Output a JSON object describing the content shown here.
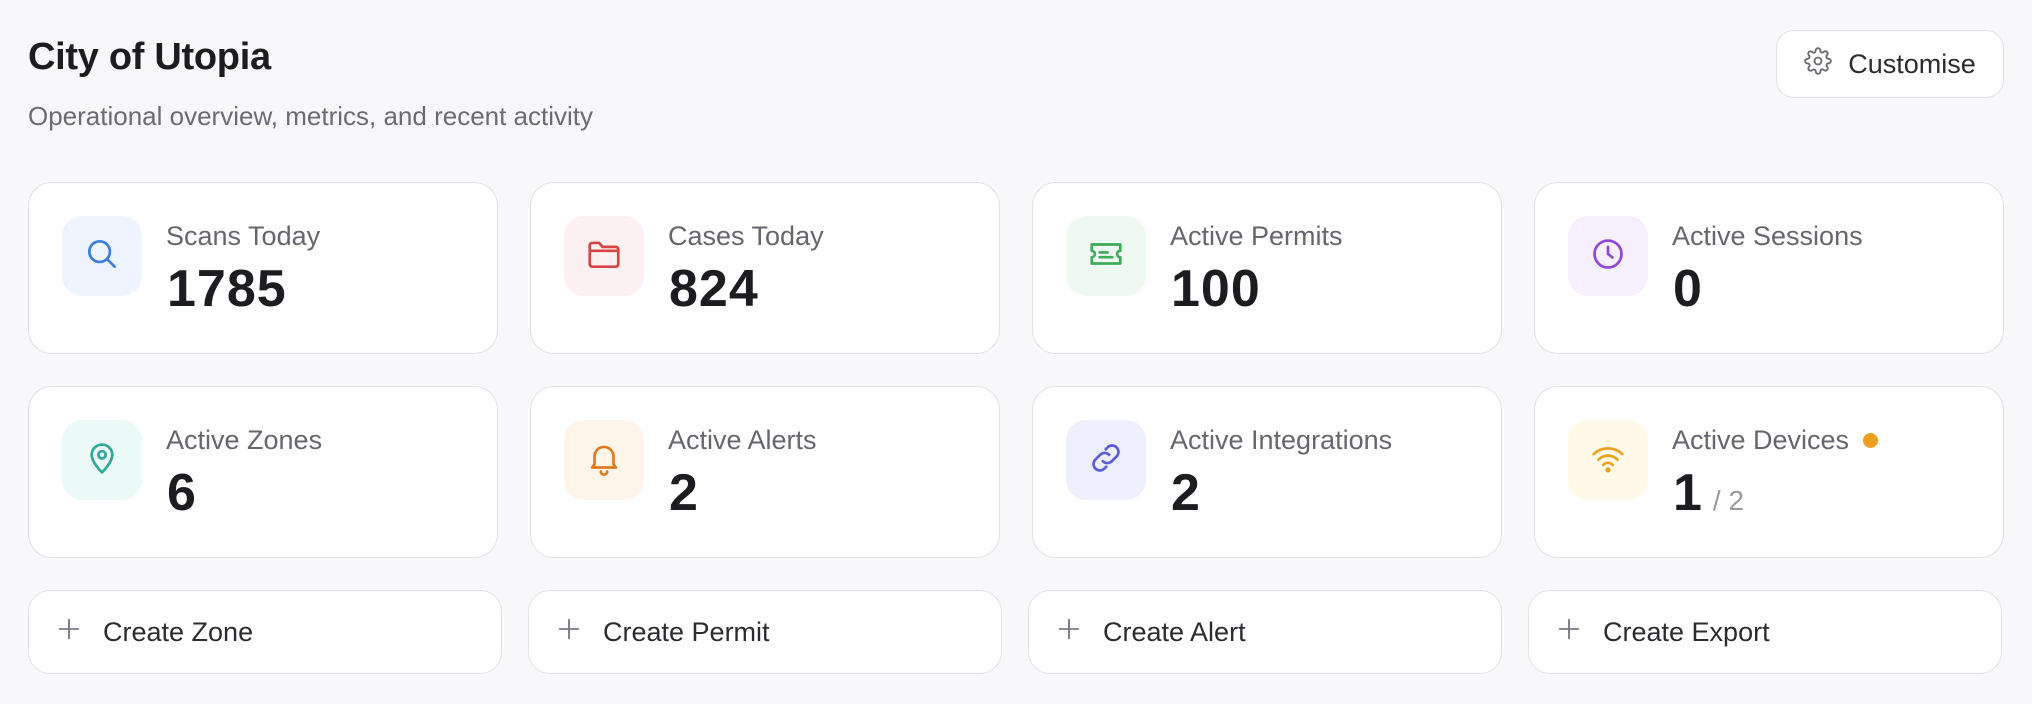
{
  "header": {
    "title": "City of Utopia",
    "subtitle": "Operational overview, metrics, and recent activity",
    "customise_label": "Customise"
  },
  "stats": [
    {
      "label": "Scans Today",
      "value": "1785",
      "icon": "search-icon",
      "color": "#3b7de0",
      "bg": "#eef4fe"
    },
    {
      "label": "Cases Today",
      "value": "824",
      "icon": "folder-icon",
      "color": "#d64545",
      "bg": "#fdf0f0"
    },
    {
      "label": "Active Permits",
      "value": "100",
      "icon": "ticket-icon",
      "color": "#3dab5a",
      "bg": "#eefaf1"
    },
    {
      "label": "Active Sessions",
      "value": "0",
      "icon": "clock-icon",
      "color": "#9146d8",
      "bg": "#f6effd"
    },
    {
      "label": "Active Zones",
      "value": "6",
      "icon": "map-pin-icon",
      "color": "#2ea89a",
      "bg": "#ecfaf7"
    },
    {
      "label": "Active Alerts",
      "value": "2",
      "icon": "bell-icon",
      "color": "#e07a1c",
      "bg": "#fef4ea"
    },
    {
      "label": "Active Integrations",
      "value": "2",
      "icon": "link-icon",
      "color": "#5a5fd6",
      "bg": "#eeeffd"
    },
    {
      "label": "Active Devices",
      "value": "1",
      "total": "/ 2",
      "icon": "wifi-icon",
      "color": "#e8a21c",
      "bg": "#fef9e8",
      "status_color": "#f0a020"
    }
  ],
  "actions": [
    {
      "label": "Create Zone"
    },
    {
      "label": "Create Permit"
    },
    {
      "label": "Create Alert"
    },
    {
      "label": "Create Export"
    }
  ]
}
